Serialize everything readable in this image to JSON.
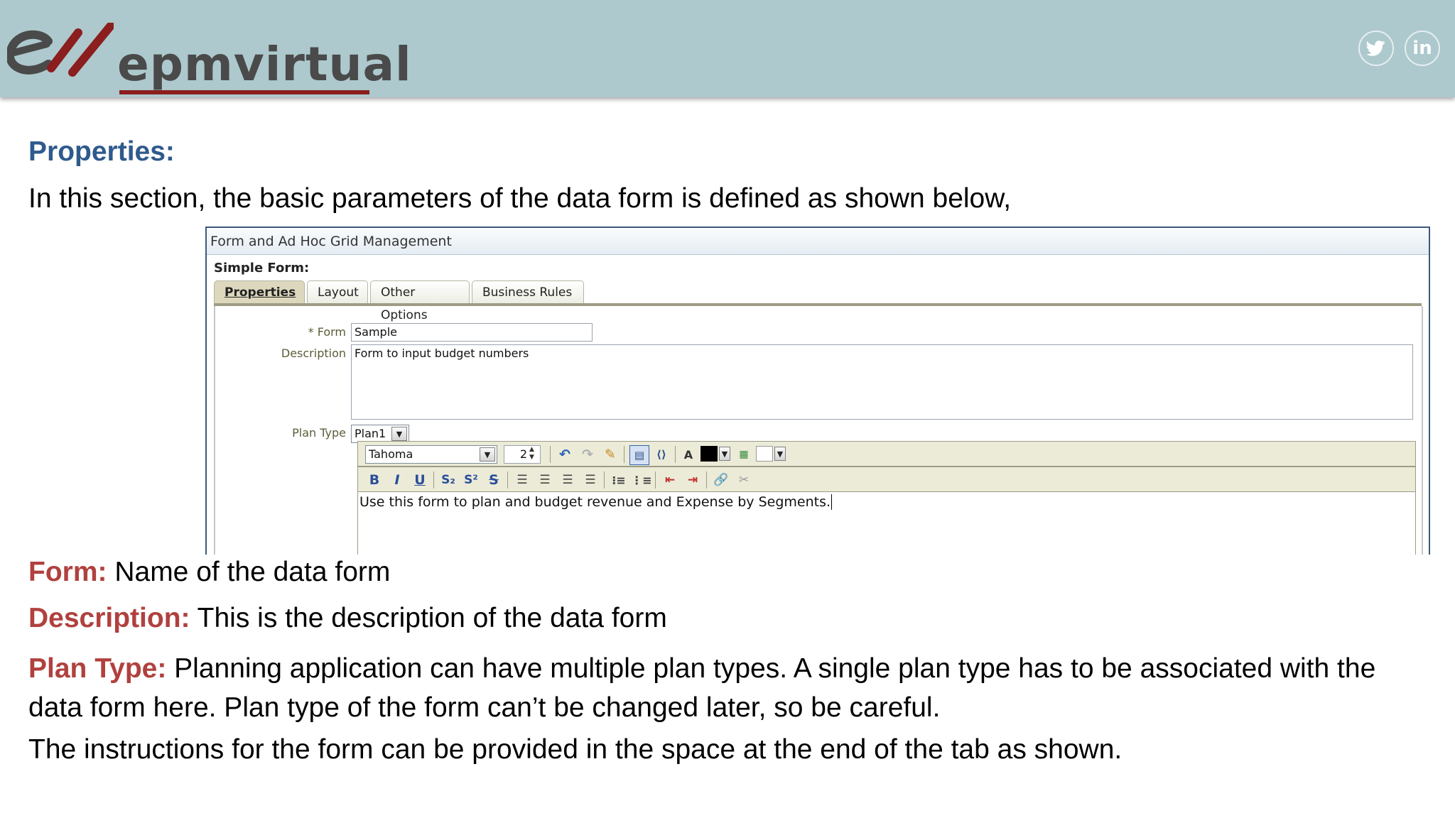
{
  "header": {
    "brand": "epmvirtual",
    "twitter_icon": "twitter-icon",
    "linkedin_label": "in",
    "colors": {
      "band": "#adc9cd",
      "brand_red": "#8b1e1e",
      "brand_gray": "#4a4a4a"
    }
  },
  "slide": {
    "heading": "Properties:",
    "intro": "In this section, the basic parameters of the data form is defined as shown below,",
    "items": [
      {
        "term": "Form:",
        "text": " Name of the data form"
      },
      {
        "term": "Description:",
        "text": " This is the description of the data form"
      },
      {
        "term": "Plan Type:",
        "text": " Planning application can have multiple plan types. A single plan type  has to be associated with the data form here. Plan type of the form can’t be changed later, so be careful."
      }
    ],
    "closing": "The instructions for the form can be provided in the space at the end of the tab as shown.",
    "colors": {
      "heading": "#2f5a8c",
      "term": "#b0413e"
    }
  },
  "screenshot": {
    "window_title": "Form and Ad Hoc Grid Management",
    "section_label": "Simple Form:",
    "tabs": [
      "Properties",
      "Layout",
      "Other Options",
      "Business Rules"
    ],
    "active_tab": "Properties",
    "form_label": "* Form",
    "form_value": "Sample",
    "description_label": "Description",
    "description_value": "Form to input budget numbers",
    "plan_type_label": "Plan Type",
    "plan_type_value": "Plan1",
    "font_value": "Tahoma",
    "font_size_value": "2",
    "instructions_text": "Use this form to plan and budget revenue and Expense by Segments."
  }
}
